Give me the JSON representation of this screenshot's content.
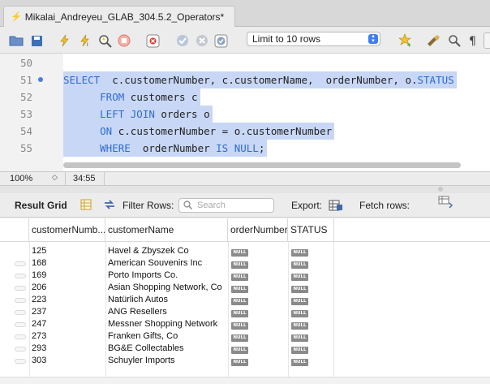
{
  "tab": {
    "title": "Mikalai_Andreyeu_GLAB_304.5.2_Operators*"
  },
  "toolbar": {
    "limit_select": "Limit to 10 rows",
    "icons": [
      "open-folder-icon",
      "save-icon",
      "execute-icon",
      "execute-current-icon",
      "explain-icon",
      "stop-icon",
      "toggle-error-icon",
      "commit-icon",
      "rollback-icon",
      "autocommit-icon",
      "add-snippet-icon",
      "beautify-icon",
      "find-icon",
      "invisible-chars-icon"
    ]
  },
  "editor": {
    "lines": [
      {
        "num": "50",
        "parts": []
      },
      {
        "num": "51",
        "parts": [
          {
            "t": "SELECT",
            "kw": true
          },
          {
            "t": "  c.customerNumber, c.customerName,  orderNumber, o.",
            "kw": false
          },
          {
            "t": "STATUS",
            "kw": true
          }
        ]
      },
      {
        "num": "52",
        "parts": [
          {
            "t": "      ",
            "kw": false
          },
          {
            "t": "FROM",
            "kw": true
          },
          {
            "t": " customers c",
            "kw": false
          }
        ]
      },
      {
        "num": "53",
        "parts": [
          {
            "t": "      ",
            "kw": false
          },
          {
            "t": "LEFT JOIN",
            "kw": true
          },
          {
            "t": " orders o",
            "kw": false
          }
        ]
      },
      {
        "num": "54",
        "parts": [
          {
            "t": "      ",
            "kw": false
          },
          {
            "t": "ON",
            "kw": true
          },
          {
            "t": " c.customerNumber = o.customerNumber",
            "kw": false
          }
        ]
      },
      {
        "num": "55",
        "parts": [
          {
            "t": "      ",
            "kw": false
          },
          {
            "t": "WHERE",
            "kw": true
          },
          {
            "t": "  orderNumber ",
            "kw": false
          },
          {
            "t": "IS NULL",
            "kw": true
          },
          {
            "t": ";",
            "kw": false
          }
        ]
      }
    ]
  },
  "status": {
    "zoom": "100%",
    "position": "34:55"
  },
  "result_bar": {
    "result_grid": "Result Grid",
    "filter_rows": "Filter Rows:",
    "search_placeholder": "Search",
    "export": "Export:",
    "fetch_rows": "Fetch rows:"
  },
  "grid": {
    "columns": [
      "customerNumb...",
      "customerName",
      "orderNumber",
      "STATUS"
    ],
    "null_label": "NULL",
    "rows": [
      [
        "125",
        "Havel & Zbyszek Co"
      ],
      [
        "168",
        "American Souvenirs Inc"
      ],
      [
        "169",
        "Porto Imports Co."
      ],
      [
        "206",
        "Asian Shopping Network, Co"
      ],
      [
        "223",
        "Natürlich Autos"
      ],
      [
        "237",
        "ANG Resellers"
      ],
      [
        "247",
        "Messner Shopping Network"
      ],
      [
        "273",
        "Franken Gifts, Co"
      ],
      [
        "293",
        "BG&E Collectables"
      ],
      [
        "303",
        "Schuyler Imports"
      ]
    ]
  }
}
